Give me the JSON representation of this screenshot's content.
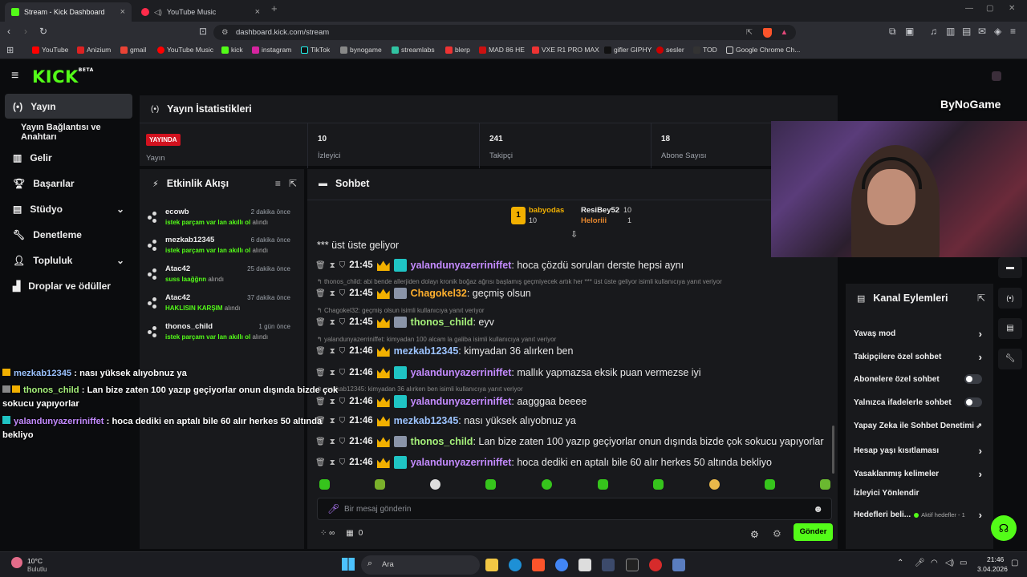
{
  "browser": {
    "tabs": [
      {
        "label": "Stream - Kick Dashboard",
        "active": true
      },
      {
        "label": "YouTube Music",
        "active": false
      }
    ],
    "url": "dashboard.kick.com/stream",
    "bookmarks": [
      "YouTube",
      "Anizium",
      "gmail",
      "YouTube Music",
      "kick",
      "instagram",
      "TikTok",
      "bynogame",
      "streamlabs",
      "blerp",
      "MAD 86 HE",
      "VXE R1 PRO MAX",
      "gifler GIPHY",
      "sesler",
      "TOD",
      "Google Chrome Ch..."
    ]
  },
  "app": {
    "logo": "KICK",
    "logo_tag": "BETA",
    "accent": "#53fc18"
  },
  "sidebar": {
    "items": [
      {
        "label": "Yayın",
        "active": true
      },
      {
        "label": "Yayın Bağlantısı ve Anahtarı"
      },
      {
        "label": "Gelir"
      },
      {
        "label": "Başarılar"
      },
      {
        "label": "Stüdyo"
      },
      {
        "label": "Denetleme"
      },
      {
        "label": "Topluluk"
      },
      {
        "label": "Droplar ve ödüller"
      }
    ]
  },
  "stats": {
    "title": "Yayın İstatistikleri",
    "live_badge": "YAYINDA",
    "live_label": "Yayın",
    "viewers_value": "10",
    "viewers_label": "İzleyici",
    "followers_value": "241",
    "followers_label": "Takipçi",
    "subs_value": "18",
    "subs_label": "Abone Sayısı"
  },
  "activity": {
    "title": "Etkinlik Akışı",
    "items": [
      {
        "user": "ecowb",
        "time": "2 dakika önce",
        "detail": "istek parçam var lan akıllı ol",
        "suffix": "alındı"
      },
      {
        "user": "mezkab12345",
        "time": "6 dakika önce",
        "detail": "istek parçam var lan akıllı ol",
        "suffix": "alındı"
      },
      {
        "user": "Atac42",
        "time": "25 dakika önce",
        "detail": "suss laağğnn",
        "suffix": "alındı"
      },
      {
        "user": "Atac42",
        "time": "37 dakika önce",
        "detail": "HAKLISIN KARŞIM",
        "suffix": "alındı"
      },
      {
        "user": "thonos_child",
        "time": "1 gün önce",
        "detail": "istek parçam var lan akıllı ol",
        "suffix": "alındı"
      }
    ]
  },
  "chat": {
    "title": "Sohbet",
    "top_gifters": [
      {
        "name": "babyodas",
        "value": "10"
      },
      {
        "name": "ResiBey52",
        "value": "10"
      },
      {
        "name": "Heloriii",
        "value": "1"
      }
    ],
    "first_line": "*** üst üste geliyor",
    "messages": [
      {
        "time": "21:45",
        "user": "yalandunyazerriniffet",
        "text": ": hoca çözdü soruları derste hepsi aynı",
        "reply": "",
        "color": "#c48bff"
      },
      {
        "time": "21:45",
        "user": "Chagokel32",
        "text": ": geçmiş olsun",
        "reply": "thonos_child: abi bende allerjiden dolayı kronik boğaz ağrısı başlamış geçmiyecek artık her *** üst üste geliyor isimli kullanıcıya yanıt veriyor",
        "color": "#ffb02e"
      },
      {
        "time": "21:45",
        "user": "thonos_child",
        "text": ": eyv",
        "reply": "Chagokel32: geçmiş olsun isimli kullanıcıya yanıt veriyor",
        "color": "#a5f07a"
      },
      {
        "time": "21:46",
        "user": "mezkab12345",
        "text": ": kimyadan 36 alırken ben",
        "reply": "yalandunyazerriniffet: kimyadan 100 alcam la galiba isimli kullanıcıya yanıt veriyor",
        "color": "#9cc3ff"
      },
      {
        "time": "21:46",
        "user": "yalandunyazerriniffet",
        "text": ": mallık yapmazsa eksik puan vermezse iyi",
        "reply": "",
        "color": "#c48bff"
      },
      {
        "time": "21:46",
        "user": "yalandunyazerriniffet",
        "text": ": aagggaa beeee",
        "reply": "mezkab12345: kimyadan 36 alırken ben isimli kullanıcıya yanıt veriyor",
        "color": "#c48bff"
      },
      {
        "time": "21:46",
        "user": "mezkab12345",
        "text": ": nası yüksek alıyobnuz ya",
        "reply": "",
        "color": "#9cc3ff"
      },
      {
        "time": "21:46",
        "user": "thonos_child",
        "text": ": Lan bize zaten 100 yazıp geçiyorlar onun dışında bizde çok sokucu yapıyorlar",
        "reply": "",
        "color": "#a5f07a"
      },
      {
        "time": "21:46",
        "user": "yalandunyazerriniffet",
        "text": ": hoca dediki en aptalı bile 60 alır herkes 50 altında bekliyo",
        "reply": "",
        "color": "#c48bff"
      }
    ],
    "input_placeholder": "Bir mesaj gönderin",
    "viewer_count": "0",
    "send_label": "Gönder"
  },
  "overlay": {
    "messages": [
      {
        "user": "mezkab12345",
        "text": " : nası yüksek alıyobnuz ya"
      },
      {
        "user": "thonos_child",
        "text": " : Lan bize zaten 100 yazıp geçiyorlar onun dışında bizde çok"
      },
      {
        "user": "",
        "text": "sokucu yapıyorlar"
      },
      {
        "user": "yalandunyazerriniffet",
        "text": " : hoca dediki en aptalı bile 60 alır herkes 50 altında"
      },
      {
        "user": "",
        "text": "bekliyo"
      }
    ],
    "brand": "ByNoGame"
  },
  "channel_actions": {
    "title": "Kanal Eylemleri",
    "items": [
      {
        "label": "Yavaş mod",
        "control": "arrow"
      },
      {
        "label": "Takipçilere özel sohbet",
        "control": "arrow"
      },
      {
        "label": "Abonelere özel sohbet",
        "control": "toggle"
      },
      {
        "label": "Yalnızca ifadelerle sohbet",
        "control": "toggle"
      },
      {
        "label": "Yapay Zeka ile Sohbet Denetimi",
        "control": "external"
      },
      {
        "label": "Hesap yaşı kısıtlaması",
        "control": "arrow"
      },
      {
        "label": "Yasaklanmış kelimeler",
        "control": "arrow"
      },
      {
        "label": "İzleyici Yönlendir",
        "control": "none"
      }
    ],
    "goals_label": "Hedefleri beli...",
    "goals_status": "Aktif hedefler - 1"
  },
  "taskbar": {
    "weather_temp": "10°C",
    "weather_desc": "Bulutlu",
    "search": "Ara",
    "time": "21:46",
    "date": "3.04.2026"
  }
}
